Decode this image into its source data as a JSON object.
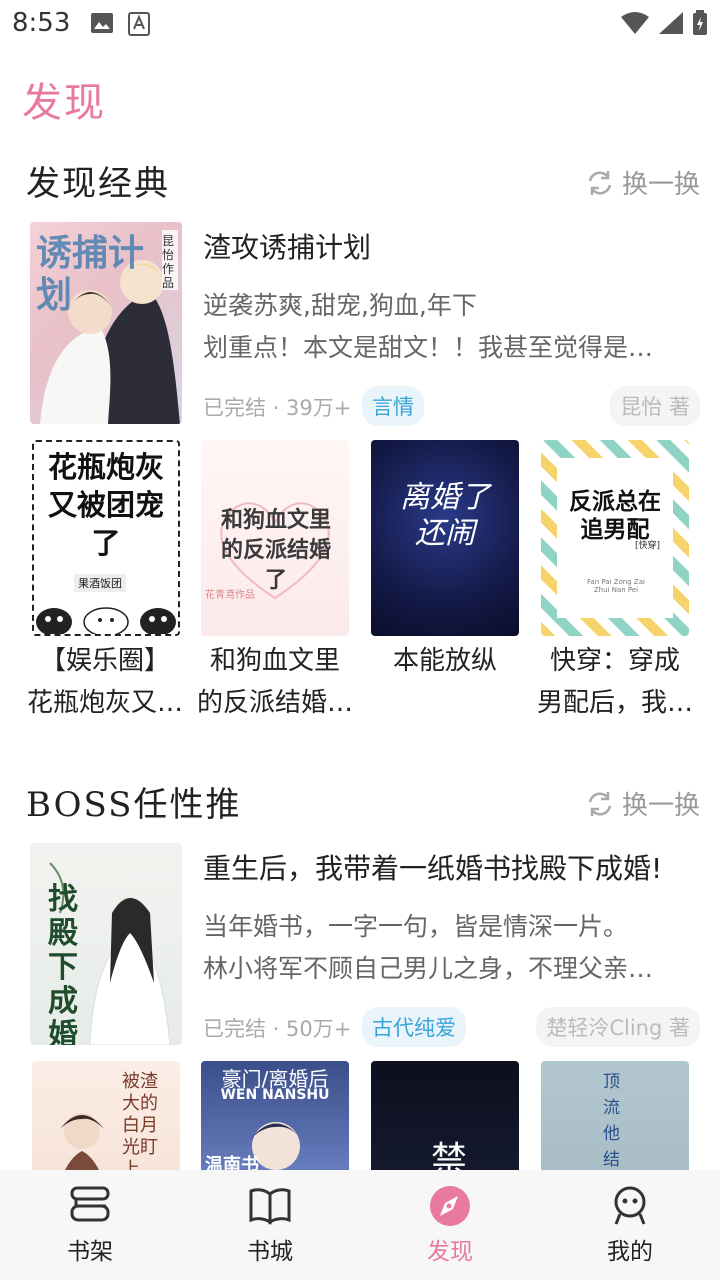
{
  "status_bar": {
    "time": "8:53"
  },
  "page_title": "发现",
  "sections": [
    {
      "title": "发现经典",
      "refresh_label": "换一换",
      "feature": {
        "title": "渣攻诱捕计划",
        "tags_line": "逆袭苏爽,甜宠,狗血,年下",
        "desc": "划重点！本文是甜文！！我甚至觉得是…",
        "meta": "已完结 · 39万+",
        "genre": "言情",
        "author": "昆怡 著",
        "cover_text": "诱捕计划",
        "cover_sub": "昆怡作品"
      },
      "books": [
        {
          "line1": "【娱乐圈】",
          "line2": "花瓶炮灰又…",
          "cover_text": "花瓶炮灰又被团宠了",
          "cover_author": "果酒饭团"
        },
        {
          "line1": "和狗血文里",
          "line2": "的反派结婚…",
          "cover_text": "和狗血文里的反派结婚了",
          "cover_author": "花青鸢作品"
        },
        {
          "line1": "本能放纵",
          "line2": "",
          "cover_text": "离婚了还闹"
        },
        {
          "line1": "快穿：穿成",
          "line2": "男配后，我…",
          "cover_text": "反派总在追男配",
          "cover_tag": "[快穿]",
          "cover_pinyin": "Fan Pai Zong Zai Zhui Nan Pei"
        }
      ]
    },
    {
      "title": "BOSS任性推",
      "refresh_label": "换一换",
      "feature": {
        "title": "重生后，我带着一纸婚书找殿下成婚!",
        "tags_line": "当年婚书，一字一句，皆是情深一片。",
        "desc": "林小将军不顾自己男儿之身，不理父亲…",
        "meta": "已完结 · 50万+",
        "genre": "古代纯爱",
        "author": "楚轻泠Cling 著",
        "cover_text": "找殿下成婚"
      },
      "books": [
        {
          "cover_text": "被渣大的白月光盯上"
        },
        {
          "cover_text": "豪门/离婚后",
          "cover_sub": "WEN NANSHU",
          "cover_author": "温南书"
        },
        {
          "cover_text": "禁"
        },
        {
          "cover_text": "顶流他结"
        }
      ]
    }
  ],
  "bottom_nav": [
    {
      "label": "书架",
      "icon": "bookshelf-icon"
    },
    {
      "label": "书城",
      "icon": "book-open-icon"
    },
    {
      "label": "发现",
      "icon": "compass-icon",
      "active": true
    },
    {
      "label": "我的",
      "icon": "profile-icon"
    }
  ],
  "colors": {
    "accent": "#e87a9e",
    "tag_bg": "#eaf5fb",
    "tag_text": "#3aa3d8",
    "nav_bg": "#f7f7f7"
  }
}
